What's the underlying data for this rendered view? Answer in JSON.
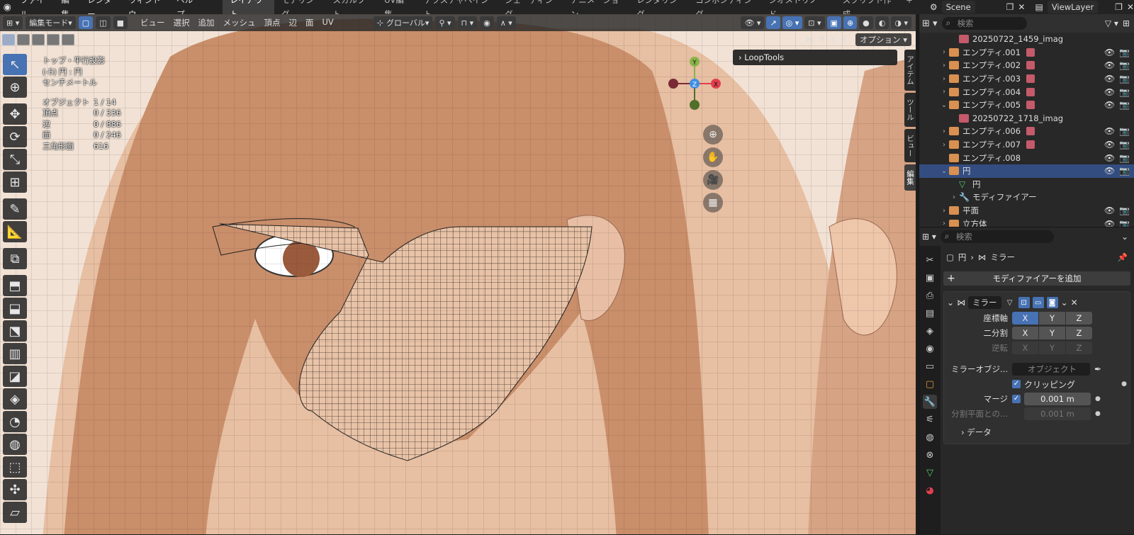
{
  "menu": [
    "ファイル",
    "編集",
    "レンダー",
    "ウィンドウ",
    "ヘルプ"
  ],
  "workspaces": [
    "レイアウト",
    "モデリング",
    "スカルプト",
    "UV編集",
    "テクスチャペイント",
    "シェーディング",
    "アニメーション",
    "レンダリング",
    "コンポジティング",
    "ジオメトリノード",
    "スクリプト作成"
  ],
  "scene": "Scene",
  "view_layer": "ViewLayer",
  "header": {
    "mode": "編集モード",
    "menus": [
      "ビュー",
      "選択",
      "追加",
      "メッシュ",
      "頂点",
      "辺",
      "面",
      "UV"
    ],
    "orientation": "グローバル",
    "options": "オプション",
    "axes": [
      "X",
      "Y",
      "Z"
    ]
  },
  "stats": {
    "view": "トップ・平行投影",
    "object": "(-5) 円 : 円",
    "unit": "センチメートル",
    "rows": [
      [
        "オブジェクト",
        "1 / 14"
      ],
      [
        "頂点",
        "0 / 336"
      ],
      [
        "辺",
        "0 / 886"
      ],
      [
        "面",
        "0 / 246"
      ],
      [
        "三角形面",
        "616"
      ]
    ]
  },
  "loop_tools": "LoopTools",
  "gizmo": {
    "y": "Y",
    "z": "Z",
    "x": "X"
  },
  "side_tabs": [
    "アイテム",
    "ツール",
    "ビュー",
    "編集"
  ],
  "outliner": {
    "search": "検索",
    "items": [
      {
        "name": "20250722_1459_imag",
        "indent": 3,
        "type": "img"
      },
      {
        "name": "エンプティ.001",
        "indent": 2,
        "type": "empty",
        "arrow": "›"
      },
      {
        "name": "エンプティ.002",
        "indent": 2,
        "type": "empty",
        "arrow": "›"
      },
      {
        "name": "エンプティ.003",
        "indent": 2,
        "type": "empty",
        "arrow": "›"
      },
      {
        "name": "エンプティ.004",
        "indent": 2,
        "type": "empty",
        "arrow": "›"
      },
      {
        "name": "エンプティ.005",
        "indent": 2,
        "type": "empty",
        "arrow": "⌄"
      },
      {
        "name": "20250722_1718_imag",
        "indent": 3,
        "type": "img"
      },
      {
        "name": "エンプティ.006",
        "indent": 2,
        "type": "empty",
        "arrow": "›"
      },
      {
        "name": "エンプティ.007",
        "indent": 2,
        "type": "empty",
        "arrow": "›"
      },
      {
        "name": "エンプティ.008",
        "indent": 2,
        "type": "empty"
      },
      {
        "name": "円",
        "indent": 2,
        "type": "mesh",
        "arrow": "⌄",
        "selected": true
      },
      {
        "name": "円",
        "indent": 3,
        "type": "meshdata"
      },
      {
        "name": "モディファイアー",
        "indent": 3,
        "type": "wrench",
        "arrow": "›"
      },
      {
        "name": "平面",
        "indent": 2,
        "type": "mesh",
        "arrow": "›"
      },
      {
        "name": "立方体",
        "indent": 2,
        "type": "mesh",
        "arrow": "›"
      }
    ]
  },
  "props": {
    "search": "検索",
    "crumb_object": "円",
    "crumb_modifier": "ミラー",
    "add_modifier": "モディファイアーを追加",
    "modifier_name": "ミラー",
    "axis_label": "座標軸",
    "bisect_label": "二分割",
    "flip_label": "逆転",
    "mirror_object_label": "ミラーオブジ...",
    "mirror_object_placeholder": "オブジェクト",
    "clipping_label": "クリッピング",
    "merge_label": "マージ",
    "merge_value": "0.001 m",
    "bisect_dist_label": "分割平面との...",
    "bisect_dist_value": "0.001 m",
    "data_label": "データ"
  }
}
